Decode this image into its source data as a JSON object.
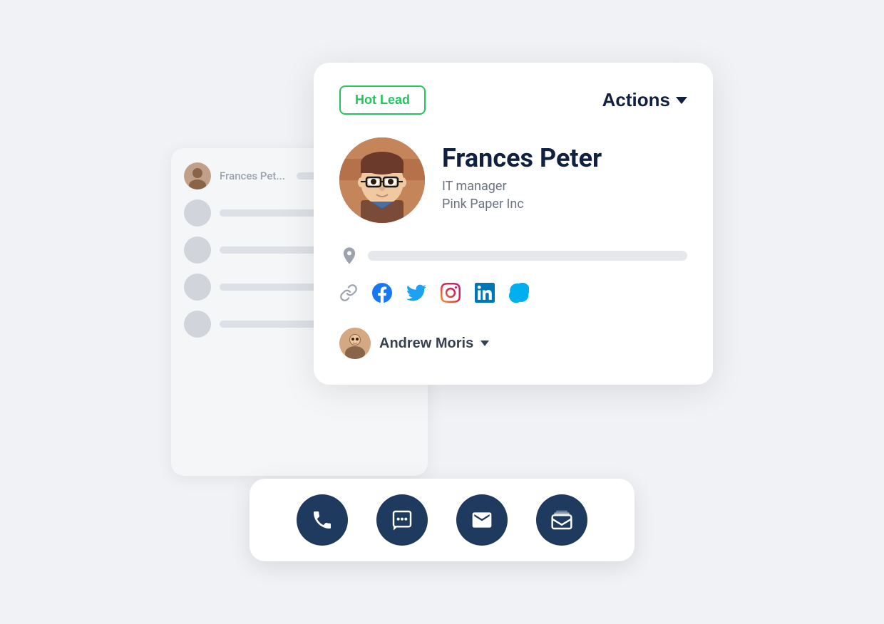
{
  "badge": {
    "label": "Hot Lead"
  },
  "actions": {
    "label": "Actions"
  },
  "profile": {
    "name": "Frances Peter",
    "title": "IT manager",
    "company": "Pink Paper Inc"
  },
  "assigned": {
    "name": "Andrew Moris"
  },
  "social": {
    "link_title": "Link",
    "facebook_title": "Facebook",
    "twitter_title": "Twitter",
    "instagram_title": "Instagram",
    "linkedin_title": "LinkedIn",
    "skype_title": "Skype"
  },
  "action_buttons": {
    "phone": "Phone Call",
    "sms": "SMS",
    "email": "Email",
    "mail": "Mail"
  },
  "bg_list": {
    "item1_name": "Frances Pet..."
  },
  "colors": {
    "accent_green": "#22c55e",
    "dark_navy": "#0f2040",
    "icon_dark": "#1e3a5f"
  }
}
